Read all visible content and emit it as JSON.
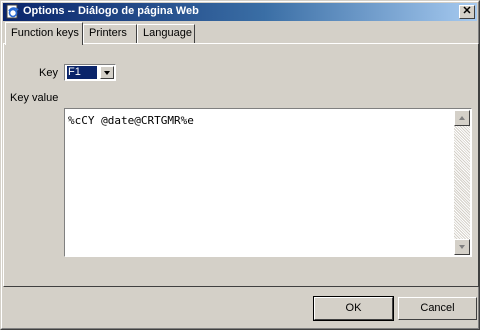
{
  "window": {
    "title": "Options -- Diálogo de página Web",
    "close_glyph": "✕"
  },
  "tabs": [
    {
      "label": "Function keys",
      "active": true
    },
    {
      "label": "Printers",
      "active": false
    },
    {
      "label": "Language",
      "active": false
    }
  ],
  "function_keys": {
    "key_label": "Key",
    "key_selected": "F1",
    "key_value_label": "Key value",
    "key_value_text": "%cCY @date@CRTGMR%e"
  },
  "buttons": {
    "ok": "OK",
    "cancel": "Cancel"
  },
  "colors": {
    "titlebar_start": "#0a246a",
    "titlebar_end": "#a6caf0",
    "selection": "#0a246a",
    "face": "#d4d0c8"
  }
}
